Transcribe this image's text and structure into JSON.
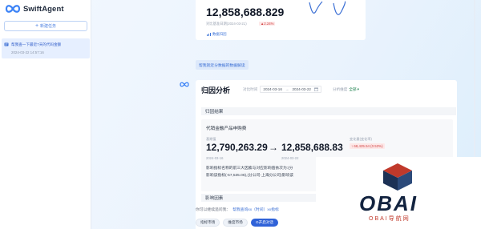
{
  "app": {
    "name": "SwiftAgent"
  },
  "sidebar": {
    "new_task_label": "新建任务",
    "tasks": [
      {
        "title": "帮我查一下最近7天的代码金额",
        "time": "2024-03-22 14:57:16"
      }
    ]
  },
  "previous_card": {
    "value": "12,858,688.829",
    "sub_label": "对比基准日期(2024-03-21)",
    "change": "2.24%",
    "link": "数据归因"
  },
  "user_message": "帮我就近分数据的数据解读",
  "analysis": {
    "title": "归因分析",
    "filter": {
      "time_label": "对比时间",
      "date_start": "2024-03-16",
      "date_end": "2024-03-22",
      "dim_label": "分析维度",
      "dim_value": "全部"
    },
    "result_label": "归因结果",
    "metric_name": "代销金融产品申购费",
    "base_label": "基期值",
    "base_value": "12,790,263.29",
    "base_date": "2024-03-16",
    "arrow": "→",
    "current_value": "12,858,688.83",
    "current_date": "2024-03-22",
    "change_label": "变化量(变化率)",
    "change_value": "68,425.54 (0.53%)",
    "text_line1": "影响指标名称的前三大因素与对应影响值依次为:(分",
    "text_line2": "影响该指标(-57,535.06),(分公司-上海分公司)影响该",
    "factors_label": "影响因素"
  },
  "suggestions": {
    "prefix": "你可以继续追问我：",
    "items": [
      "帮我查询xx（时间）xx指标"
    ]
  },
  "chips": [
    "指标市场",
    "维度市场",
    "开启对话"
  ],
  "watermark": {
    "text": "OBAI",
    "sub": "OBAI导航网"
  },
  "colors": {
    "accent": "#2f62d8",
    "negative": "#d14343",
    "positive_dim": "#1a7f4b"
  }
}
